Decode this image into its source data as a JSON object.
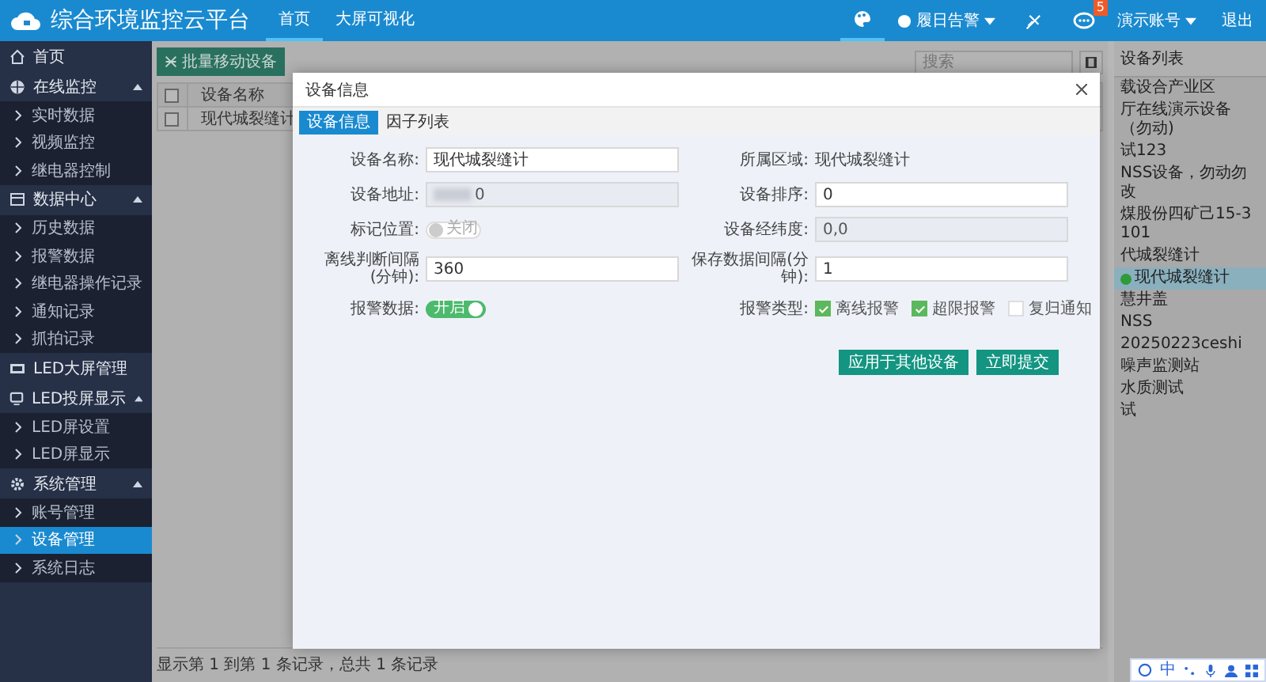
{
  "header": {
    "title": "综合环境监控云平台",
    "nav": [
      {
        "label": "首页",
        "selected": true
      },
      {
        "label": "大屏可视化",
        "selected": false
      }
    ],
    "alarm_menu": "履日告警",
    "message_badge": "5",
    "user_menu": "演示账号",
    "logout": "退出"
  },
  "sidebar": {
    "items": [
      {
        "label": "首页",
        "selected": false
      },
      {
        "label": "在线监控",
        "expanded": true,
        "children": [
          {
            "label": "实时数据",
            "selected": false
          },
          {
            "label": "视频监控",
            "selected": false
          },
          {
            "label": "继电器控制",
            "selected": false
          }
        ]
      },
      {
        "label": "数据中心",
        "expanded": true,
        "children": [
          {
            "label": "历史数据",
            "selected": false
          },
          {
            "label": "报警数据",
            "selected": false
          },
          {
            "label": "继电器操作记录",
            "selected": false
          },
          {
            "label": "通知记录",
            "selected": false
          },
          {
            "label": "抓拍记录",
            "selected": false
          }
        ]
      },
      {
        "label": "LED大屏管理",
        "selected": false
      },
      {
        "label": "LED投屏显示",
        "expanded": true,
        "children": [
          {
            "label": "LED屏设置",
            "selected": false
          },
          {
            "label": "LED屏显示",
            "selected": false
          }
        ]
      },
      {
        "label": "系统管理",
        "expanded": true,
        "children": [
          {
            "label": "账号管理",
            "selected": false
          },
          {
            "label": "设备管理",
            "selected": true
          },
          {
            "label": "系统日志",
            "selected": false
          }
        ]
      }
    ]
  },
  "toolbar": {
    "batch_move_button": "批量移动设备",
    "search": {
      "placeholder": "搜索"
    }
  },
  "table": {
    "columns": [
      "设备名称"
    ],
    "header_checked": false,
    "rows": [
      {
        "checked": false,
        "cells": [
          "现代城裂缝计"
        ]
      }
    ],
    "footer": "显示第 1 到第 1 条记录，总共 1 条记录"
  },
  "device_list": {
    "title": "设备列表",
    "items": [
      {
        "label": "载设合产业区",
        "selected": false
      },
      {
        "label": "厅在线演示设备（勿动)",
        "selected": false
      },
      {
        "label": "试123",
        "selected": false
      },
      {
        "label": "NSS设备，勿动勿改",
        "selected": false
      },
      {
        "label": "煤股份四矿己15-3101",
        "selected": false
      },
      {
        "label": "代城裂缝计",
        "selected": false
      },
      {
        "label": "现代城裂缝计",
        "selected": true
      },
      {
        "label": "慧井盖",
        "selected": false
      },
      {
        "label": "NSS",
        "selected": false
      },
      {
        "label": "20250223ceshi",
        "selected": false
      },
      {
        "label": "噪声监测站",
        "selected": false
      },
      {
        "label": "水质测试",
        "selected": false
      },
      {
        "label": "试",
        "selected": false
      }
    ]
  },
  "dialog": {
    "title": "设备信息",
    "tabs": [
      {
        "label": "设备信息",
        "selected": true
      },
      {
        "label": "因子列表",
        "selected": false
      }
    ],
    "fields": [
      {
        "kind": "input",
        "label": "设备名称:",
        "value": "现代城裂缝计",
        "disabled": false
      },
      {
        "kind": "text",
        "label": "所属区域:",
        "value": "现代城裂缝计"
      },
      {
        "kind": "input",
        "label": "设备地址:",
        "value": "0",
        "disabled": true,
        "redacted": true
      },
      {
        "kind": "input",
        "label": "设备排序:",
        "value": "0",
        "disabled": false
      },
      {
        "kind": "toggle",
        "label": "标记位置:",
        "on": false,
        "text": "关闭"
      },
      {
        "kind": "input",
        "label": "设备经纬度:",
        "value": "0,0",
        "disabled": true
      },
      {
        "kind": "input",
        "label": "离线判断间隔(分钟):",
        "value": "360",
        "disabled": false
      },
      {
        "kind": "input",
        "label": "保存数据间隔(分钟):",
        "value": "1",
        "disabled": false
      },
      {
        "kind": "toggle",
        "label": "报警数据:",
        "on": true,
        "text": "开启"
      },
      {
        "kind": "checks",
        "label": "报警类型:",
        "options": [
          {
            "label": "离线报警",
            "checked": true
          },
          {
            "label": "超限报警",
            "checked": true
          },
          {
            "label": "复归通知",
            "checked": false
          }
        ]
      }
    ],
    "buttons": [
      "应用于其他设备",
      "立即提交"
    ]
  },
  "ime_bar": {
    "label": "中"
  }
}
